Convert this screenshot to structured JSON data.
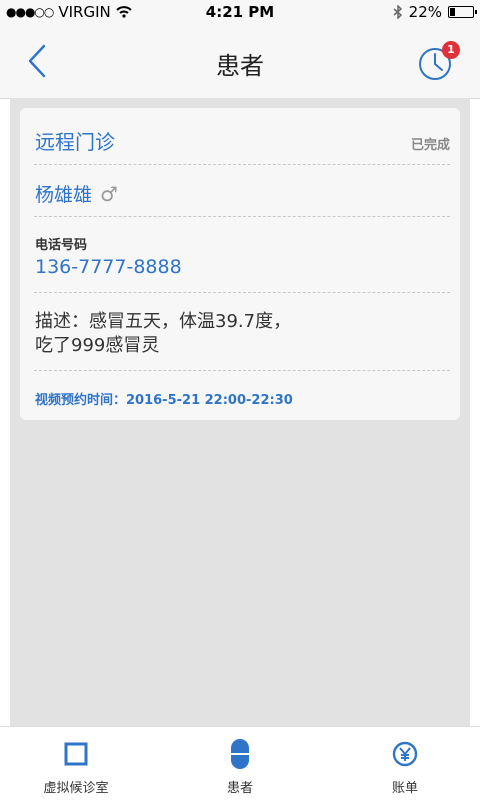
{
  "status_bar": {
    "signal": "●●●○○",
    "carrier": "VIRGIN",
    "time": "4:21 PM",
    "battery": "22%",
    "battery_level": 0.22
  },
  "nav": {
    "title": "患者",
    "badge_count": "1"
  },
  "card": {
    "type": "远程门诊",
    "status": "已完成",
    "patient_name": "杨雄雄",
    "gender_symbol": "♂",
    "phone_label": "电话号码",
    "phone": "136-7777-8888",
    "description_line1": "描述：感冒五天，体温39.7度，",
    "description_line2": "吃了999感冒灵",
    "appointment": "视频预约时间：2016-5-21 22:00-22:30"
  },
  "tabbar": {
    "tabs": [
      {
        "label": "虚拟候诊室",
        "icon": "square-icon"
      },
      {
        "label": "患者",
        "icon": "capsule-icon"
      },
      {
        "label": "账单",
        "icon": "yen-icon"
      }
    ]
  },
  "colors": {
    "accent": "#2f74c8",
    "badge": "#e0303a",
    "background": "#e2e2e2"
  }
}
